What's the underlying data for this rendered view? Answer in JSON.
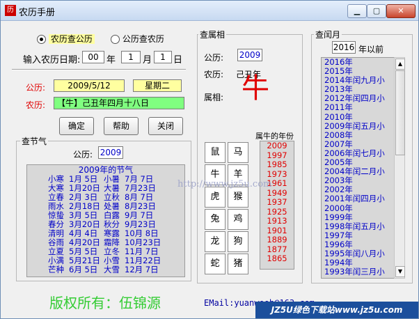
{
  "window": {
    "title": "农历手册",
    "icon_text": "历"
  },
  "mode": {
    "option1": "农历查公历",
    "option2": "公历查农历",
    "selected": "option1"
  },
  "input": {
    "label": "输入农历日期:",
    "year": "00",
    "year_unit": "年",
    "month": "1",
    "month_unit": "月",
    "day": "1",
    "day_unit": "日"
  },
  "result": {
    "gregorian_label": "公历:",
    "gregorian_value": "2009/5/12",
    "weekday": "星期二",
    "lunar_label": "农历:",
    "lunar_value": "【牛】己丑年四月十八日"
  },
  "buttons": {
    "ok": "确定",
    "help": "帮助",
    "close": "关闭"
  },
  "jieqi": {
    "group_title": "查节气",
    "year_label": "公历:",
    "year_value": "2009",
    "list_title": "2009年的节气",
    "rows": [
      [
        "小寒",
        "1月 5日",
        "小暑",
        "7月 7日"
      ],
      [
        "大寒",
        "1月20日",
        "大暑",
        "7月23日"
      ],
      [
        "立春",
        "2月 3日",
        "立秋",
        "8月 7日"
      ],
      [
        "雨水",
        "2月18日",
        "处暑",
        "8月23日"
      ],
      [
        "惊蛰",
        "3月 5日",
        "白露",
        "9月 7日"
      ],
      [
        "春分",
        "3月20日",
        "秋分",
        "9月23日"
      ],
      [
        "清明",
        "4月 4日",
        "寒露",
        "10月 8日"
      ],
      [
        "谷雨",
        "4月20日",
        "霜降",
        "10月23日"
      ],
      [
        "立夏",
        "5月 5日",
        "立冬",
        "11月 7日"
      ],
      [
        "小满",
        "5月21日",
        "小雪",
        "11月22日"
      ],
      [
        "芒种",
        "6月 5日",
        "大雪",
        "12月 7日"
      ]
    ]
  },
  "shuxiang": {
    "group_title": "查属相",
    "gregorian_label": "公历:",
    "gregorian_value": "2009",
    "lunar_label": "农历:",
    "lunar_value": "己丑年",
    "animal_label": "属相:",
    "animal": "牛",
    "animals": [
      "鼠",
      "马",
      "牛",
      "羊",
      "虎",
      "猴",
      "兔",
      "鸡",
      "龙",
      "狗",
      "蛇",
      "猪"
    ],
    "years_title": "属牛的年份",
    "years": [
      "2009",
      "1997",
      "1985",
      "1973",
      "1961",
      "1949",
      "1937",
      "1925",
      "1913",
      "1901",
      "1889",
      "1877",
      "1865"
    ]
  },
  "runyue": {
    "group_title": "查闰月",
    "year_value": "2016",
    "year_suffix": "年以前",
    "items": [
      "2016年",
      "2015年",
      "2014年闰九月小",
      "2013年",
      "2012年闰四月小",
      "2011年",
      "2010年",
      "2009年闰五月小",
      "2008年",
      "2007年",
      "2006年闰七月小",
      "2005年",
      "2004年闰二月小",
      "2003年",
      "2002年",
      "2001年闰四月小",
      "2000年",
      "1999年",
      "1998年闰五月小",
      "1997年",
      "1996年",
      "1995年闰八月小",
      "1994年",
      "1993年闰三月小"
    ]
  },
  "footer": {
    "copyright": "版权所有：伍锦源",
    "email": "EMail:yuanwooh@163.com",
    "watermark": "http://www.jz5u.com",
    "brand": "JZ5U绿色下载站www.jz5u.com"
  },
  "colors": {
    "accent_green": "#33cc33",
    "red": "#ff0000",
    "blue": "#0000c8"
  }
}
